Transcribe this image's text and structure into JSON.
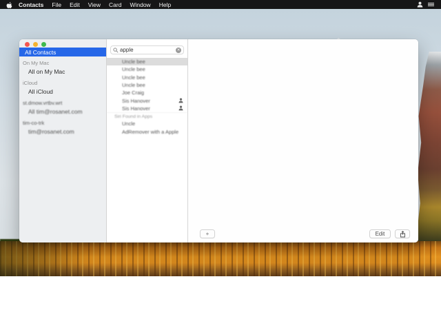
{
  "colors": {
    "accent_blue": "#2667e8",
    "menubar_bg": "#161617",
    "selection_gray": "#dcdcdc",
    "water_orange": "#e08a1e"
  },
  "menu_bar": {
    "apple_icon": "apple-icon",
    "app_menu": "Contacts",
    "items": [
      "File",
      "Edit",
      "View",
      "Card",
      "Window",
      "Help"
    ],
    "right_icons": [
      "user-icon",
      "list-icon"
    ]
  },
  "window": {
    "sidebar": {
      "selected_item": "All Contacts",
      "rows": [
        {
          "type": "header",
          "label": "On My Mac"
        },
        {
          "type": "item",
          "label": "All on My Mac"
        },
        {
          "type": "header",
          "label": "iCloud"
        },
        {
          "type": "item",
          "label": "All iCloud"
        },
        {
          "type": "header",
          "label": "st.dmow.vrtbv.wrt",
          "blurred": true
        },
        {
          "type": "item",
          "label": "All tim@rosanet.com",
          "blurred": true
        },
        {
          "type": "header",
          "label": "tim-co-trk",
          "blurred": true
        },
        {
          "type": "item",
          "label": "tim@rosanet.com",
          "blurred": true
        }
      ]
    },
    "search": {
      "value": "apple",
      "icons": [
        "search-icon",
        "clear-icon"
      ]
    },
    "results": [
      {
        "name": "Uncle bee",
        "selected": true,
        "blurred": true
      },
      {
        "name": "Uncle bee",
        "blurred": true
      },
      {
        "name": "Uncle bee",
        "blurred": true
      },
      {
        "name": "Uncle bee",
        "blurred": true
      },
      {
        "name": "Joe Craig",
        "blurred": true
      },
      {
        "name": "Sis Hanover",
        "suggested": true,
        "blurred": true
      },
      {
        "name": "Sis Hanover",
        "suggested": true,
        "blurred": true
      },
      {
        "name": "Siri Found in Apps",
        "type": "header",
        "blurred": true
      },
      {
        "name": "Uncle",
        "blurred": true
      },
      {
        "name": "AdRemover with a Apple",
        "blurred": true
      }
    ],
    "footer": {
      "add_label": "+",
      "edit_label": "Edit",
      "share_icon": "share-icon"
    }
  }
}
